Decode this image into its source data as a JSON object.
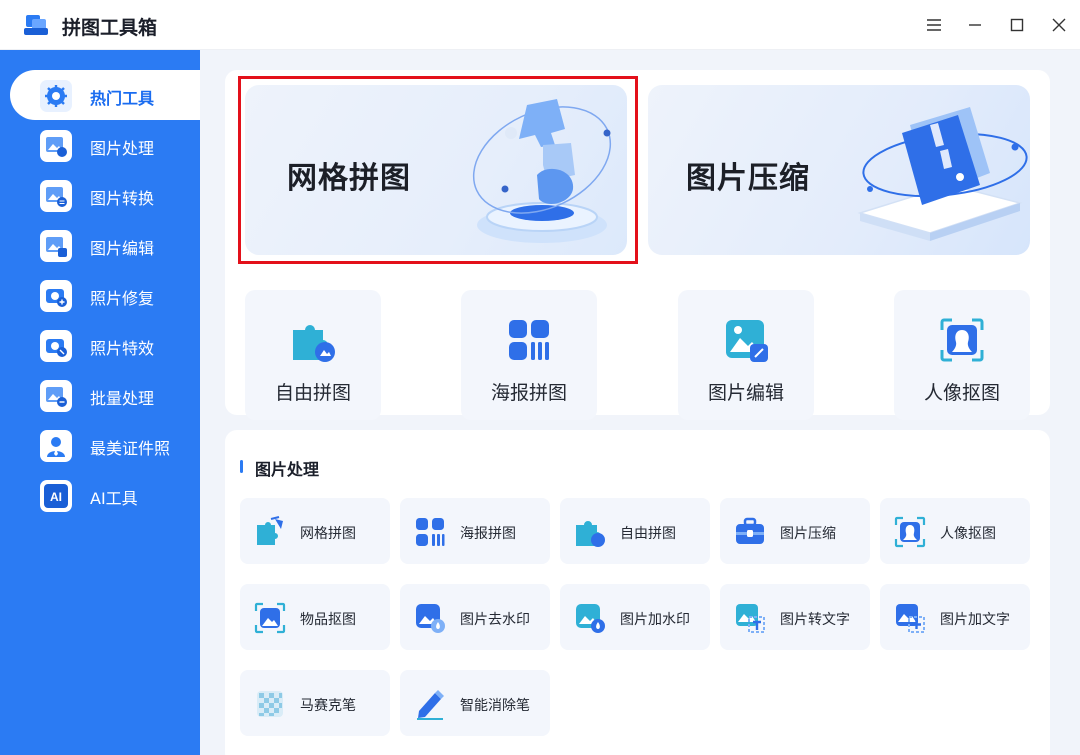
{
  "app": {
    "title": "拼图工具箱"
  },
  "sidebar": {
    "items": [
      {
        "label": "热门工具",
        "icon": "gear-icon"
      },
      {
        "label": "图片处理",
        "icon": "image-process-icon"
      },
      {
        "label": "图片转换",
        "icon": "image-convert-icon"
      },
      {
        "label": "图片编辑",
        "icon": "image-edit-icon"
      },
      {
        "label": "照片修复",
        "icon": "photo-repair-icon"
      },
      {
        "label": "照片特效",
        "icon": "photo-effect-icon"
      },
      {
        "label": "批量处理",
        "icon": "batch-process-icon"
      },
      {
        "label": "最美证件照",
        "icon": "id-photo-icon"
      },
      {
        "label": "AI工具",
        "icon": "ai-icon"
      }
    ]
  },
  "banners": [
    {
      "title": "网格拼图"
    },
    {
      "title": "图片压缩"
    }
  ],
  "tools": [
    {
      "label": "自由拼图"
    },
    {
      "label": "海报拼图"
    },
    {
      "label": "图片编辑"
    },
    {
      "label": "人像抠图"
    }
  ],
  "section": {
    "title": "图片处理",
    "items": [
      {
        "label": "网格拼图"
      },
      {
        "label": "海报拼图"
      },
      {
        "label": "自由拼图"
      },
      {
        "label": "图片压缩"
      },
      {
        "label": "人像抠图"
      },
      {
        "label": "物品抠图"
      },
      {
        "label": "图片去水印"
      },
      {
        "label": "图片加水印"
      },
      {
        "label": "图片转文字"
      },
      {
        "label": "图片加文字"
      },
      {
        "label": "马赛克笔"
      },
      {
        "label": "智能消除笔"
      }
    ]
  },
  "colors": {
    "accent": "#2b7bf3",
    "highlight": "#e3101a"
  }
}
